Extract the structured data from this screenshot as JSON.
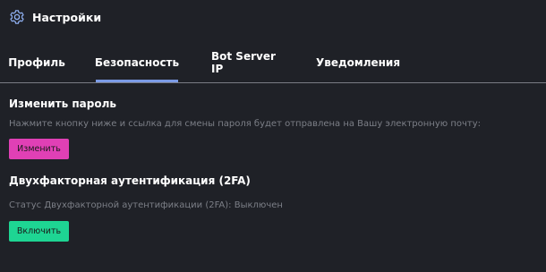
{
  "header": {
    "title": "Настройки",
    "icon": "gear-icon"
  },
  "tabs": [
    {
      "label": "Профиль",
      "active": false
    },
    {
      "label": "Безопасность",
      "active": true
    },
    {
      "label": "Bot Server IP",
      "active": false
    },
    {
      "label": "Уведомления",
      "active": false
    }
  ],
  "password": {
    "title": "Изменить пароль",
    "description": "Нажмите кнопку ниже и ссылка для смены пароля будет отправлена на Вашу электронную почту:",
    "button_label": "Изменить"
  },
  "twofa": {
    "title": "Двухфакторная аутентификация (2FA)",
    "status_text": "Статус Двухфакторной аутентификации (2FA): Выключен",
    "button_label": "Включить"
  },
  "colors": {
    "background": "#1f2127",
    "accent_tab": "#7b9be6",
    "pink_button": "#e040b5",
    "green_button": "#1ed593"
  }
}
